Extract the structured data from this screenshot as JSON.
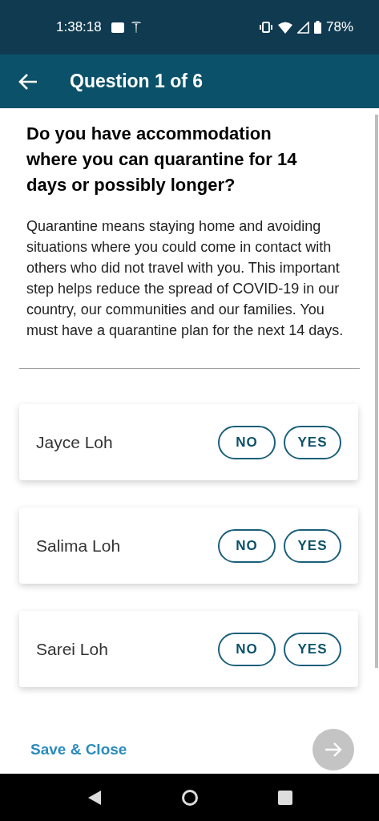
{
  "status_bar": {
    "time": "1:38:18",
    "battery": "78%"
  },
  "app_bar": {
    "title": "Question 1 of 6"
  },
  "question": {
    "title": "Do you have accommodation where you can quarantine for 14 days or possibly longer?",
    "description": "Quarantine means staying home and avoiding situations where you could come in contact with others who did not travel with you. This important step helps reduce the spread of COVID-19 in our country, our communities and our families. You must have a quarantine plan for the next 14 days."
  },
  "travellers": [
    {
      "name": "Jayce Loh",
      "answers": [
        {
          "label": "NO",
          "selected": false
        },
        {
          "label": "YES",
          "selected": false
        }
      ]
    },
    {
      "name": "Salima Loh",
      "answers": [
        {
          "label": "NO",
          "selected": false
        },
        {
          "label": "YES",
          "selected": false
        }
      ]
    },
    {
      "name": "Sarei Loh",
      "answers": [
        {
          "label": "NO",
          "selected": false
        },
        {
          "label": "YES",
          "selected": false
        }
      ]
    }
  ],
  "footer": {
    "save_link": "Save & Close",
    "next_disabled": true
  }
}
